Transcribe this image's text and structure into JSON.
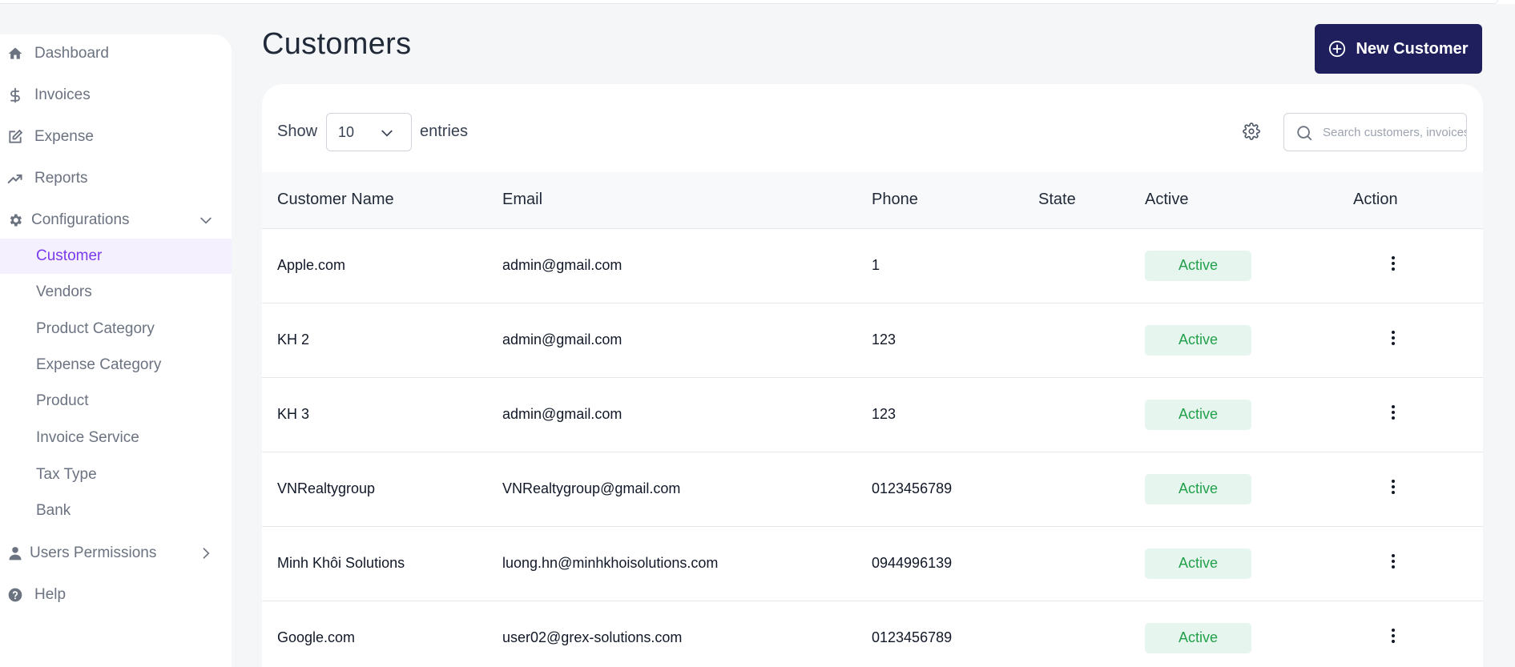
{
  "sidebar": {
    "items": [
      {
        "label": "Dashboard",
        "icon": "home-icon"
      },
      {
        "label": "Invoices",
        "icon": "dollar-icon"
      },
      {
        "label": "Expense",
        "icon": "edit-icon"
      },
      {
        "label": "Reports",
        "icon": "trending-up-icon"
      },
      {
        "label": "Configurations",
        "icon": "gear-icon"
      }
    ],
    "config_sub": [
      "Customer",
      "Vendors",
      "Product Category",
      "Expense Category",
      "Product",
      "Invoice Service",
      "Tax Type",
      "Bank"
    ],
    "active_sub": "Customer",
    "users_permissions": "Users Permissions",
    "help": "Help"
  },
  "page": {
    "title": "Customers",
    "new_button": "New Customer"
  },
  "toolbar": {
    "show_label": "Show",
    "entries_value": "10",
    "entries_label": "entries",
    "search_placeholder": "Search customers, invoices"
  },
  "table": {
    "columns": [
      "Customer Name",
      "Email",
      "Phone",
      "State",
      "Active",
      "Action"
    ],
    "rows": [
      {
        "name": "Apple.com",
        "email": "admin@gmail.com",
        "phone": "1",
        "state": "",
        "status": "Active"
      },
      {
        "name": "KH 2",
        "email": "admin@gmail.com",
        "phone": "123",
        "state": "",
        "status": "Active"
      },
      {
        "name": "KH 3",
        "email": "admin@gmail.com",
        "phone": "123",
        "state": "",
        "status": "Active"
      },
      {
        "name": "VNRealtygroup",
        "email": "VNRealtygroup@gmail.com",
        "phone": "0123456789",
        "state": "",
        "status": "Active"
      },
      {
        "name": "Minh Khôi Solutions",
        "email": "luong.hn@minhkhoisolutions.com",
        "phone": "0944996139",
        "state": "",
        "status": "Active"
      },
      {
        "name": "Google.com",
        "email": "user02@grex-solutions.com",
        "phone": "0123456789",
        "state": "",
        "status": "Active"
      }
    ]
  },
  "colors": {
    "primary_button": "#1e1f5c",
    "active_nav": "#7c3aed",
    "active_nav_bg": "#f4f0fd",
    "badge_bg": "#e6f6ee",
    "badge_text": "#22a04b"
  }
}
